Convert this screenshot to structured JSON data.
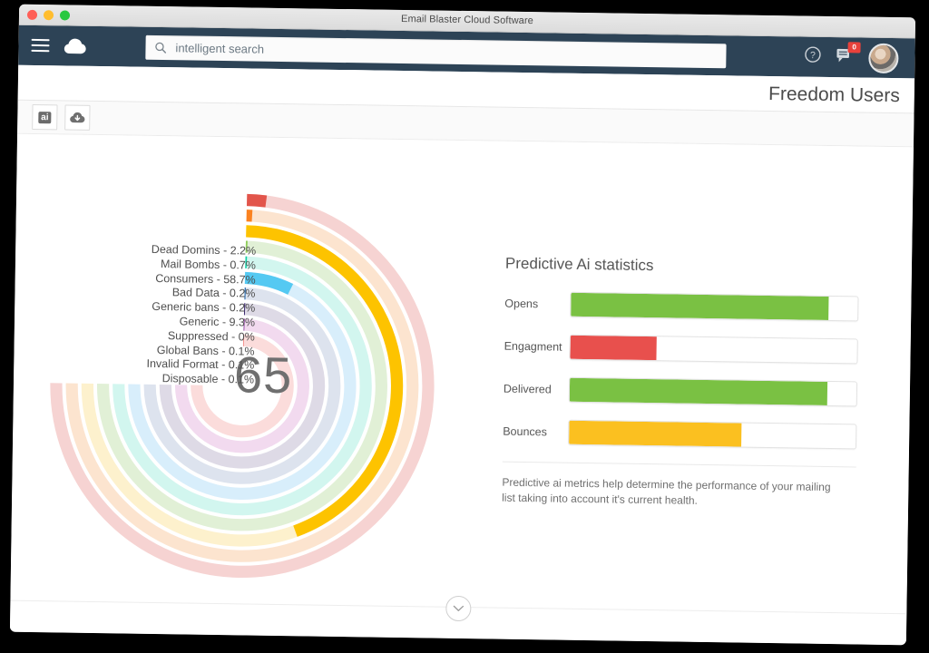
{
  "window": {
    "title": "Email Blaster Cloud Software",
    "traffic_lights": [
      "close",
      "minimize",
      "zoom"
    ]
  },
  "topnav": {
    "menu_icon": "hamburger-icon",
    "logo_icon": "cloud-logo-icon",
    "search": {
      "placeholder": "intelligent search",
      "value": "",
      "icon": "search-icon"
    },
    "help_icon": "question-mark-icon",
    "messages_icon": "message-icon",
    "messages_badge": "0",
    "avatar": "user-avatar"
  },
  "subheader": {
    "page_title": "Freedom Users"
  },
  "toolbar": {
    "buttons": [
      {
        "name": "ai-button",
        "label": "ai",
        "icon": "ai-chip-icon"
      },
      {
        "name": "cloud-download-button",
        "label": "",
        "icon": "cloud-download-icon"
      }
    ]
  },
  "gauge": {
    "value": "65",
    "max_sweep_degrees": 270
  },
  "stats": {
    "title": "Predictive Ai statistics",
    "description": "Predictive ai metrics help determine the performance of your mailing list taking into account it's current health."
  },
  "footer": {
    "expand_icon": "chevron-down-icon"
  },
  "chart_data": [
    {
      "type": "bar",
      "chart_name": "list-health-radial-chart",
      "orientation": "radial",
      "title": "",
      "center_label": "65",
      "sweep_degrees": 270,
      "start_angle_degrees": 0,
      "categories": [
        "Dead Domins",
        "Mail Bombs",
        "Consumers",
        "Bad Data",
        "Generic bans",
        "Generic",
        "Suppressed",
        "Global Bans",
        "Invalid Format",
        "Disposable"
      ],
      "values": [
        2.2,
        0.7,
        58.7,
        0.2,
        0.2,
        9.3,
        0.0,
        0.1,
        0.1,
        0.1
      ],
      "unit": "%",
      "legend_labels": [
        "Dead Domins - 2.2%",
        "Mail Bombs - 0.7%",
        "Consumers - 58.7%",
        "Bad Data - 0.2%",
        "Generic bans - 0.2%",
        "Generic - 9.3%",
        "Suppressed - 0%",
        "Global Bans - 0.1%",
        "Invalid Format - 0.1%",
        "Disposable - 0.1%"
      ],
      "colors": [
        "#e2554b",
        "#fb8220",
        "#fdc300",
        "#8fce5a",
        "#0fcfa5",
        "#55c9f2",
        "#2f6fb0",
        "#35216b",
        "#7a1f93",
        "#ef5a53"
      ],
      "track_colors": [
        "#f6d3d2",
        "#fce4cf",
        "#fdf1cd",
        "#e1f0d6",
        "#d2f6ef",
        "#d8eefb",
        "#dde3ee",
        "#dedae6",
        "#f2daef",
        "#fbdcdb"
      ],
      "legend_position": "left",
      "grid": false
    },
    {
      "type": "bar",
      "chart_name": "predictive-ai-statistics",
      "orientation": "horizontal",
      "title": "Predictive Ai statistics",
      "categories": [
        "Opens",
        "Engagment",
        "Delivered",
        "Bounces"
      ],
      "values": [
        90,
        30,
        90,
        60
      ],
      "unit": "%",
      "xlim": [
        0,
        100
      ],
      "colors": [
        "#7ac143",
        "#e8504d",
        "#7ac143",
        "#fbc020"
      ],
      "xlabel": "",
      "ylabel": "",
      "grid": false,
      "legend_position": "none"
    }
  ]
}
